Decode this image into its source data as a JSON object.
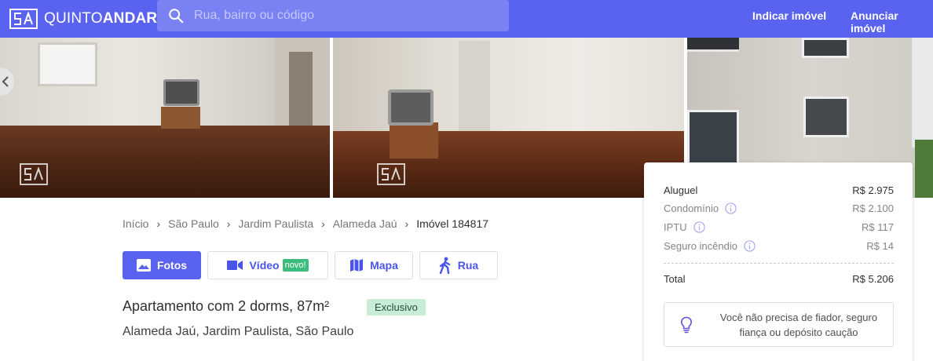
{
  "header": {
    "logo_text_light": "QUINTO",
    "logo_text_bold": "ANDAR",
    "search_placeholder": "Rua, bairro ou código",
    "nav": [
      "Indicar imóvel",
      "Anunciar imóvel"
    ]
  },
  "breadcrumb": [
    "Início",
    "São Paulo",
    "Jardim Paulista",
    "Alameda Jaú",
    "Imóvel 184817"
  ],
  "media_buttons": {
    "photos": "Fotos",
    "video": "Vídeo",
    "video_badge": "novo!",
    "map": "Mapa",
    "street": "Rua"
  },
  "listing": {
    "title": "Apartamento com 2 dorms, 87m²",
    "badge": "Exclusivo",
    "address": "Alameda Jaú, Jardim Paulista, São Paulo"
  },
  "price_card": {
    "rent_label": "Aluguel",
    "rent_value": "R$ 2.975",
    "condo_label": "Condomínio",
    "condo_value": "R$ 2.100",
    "iptu_label": "IPTU",
    "iptu_value": "R$ 117",
    "insurance_label": "Seguro incêndio",
    "insurance_value": "R$ 14",
    "total_label": "Total",
    "total_value": "R$ 5.206",
    "tip_text": "Você não precisa de fiador, seguro fiança ou depósito caução"
  },
  "colors": {
    "brand": "#5a63ef",
    "badge_green": "#3dbd7d",
    "exclusive_bg": "#c7edd6"
  },
  "icons": [
    "search-icon",
    "photo-icon",
    "video-icon",
    "map-icon",
    "walk-icon",
    "info-icon",
    "lightbulb-icon",
    "chevron-left-icon"
  ]
}
